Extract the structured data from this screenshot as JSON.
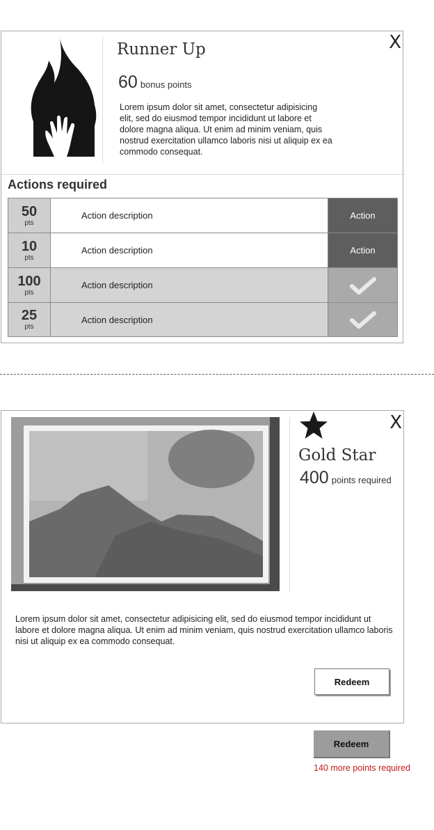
{
  "badge_card": {
    "icon": "flame-hand-icon",
    "title": "Runner Up",
    "points_value": "60",
    "points_label": "bonus points",
    "description": "Lorem ipsum dolor sit amet, consectetur adipisicing elit, sed do eiusmod tempor incididunt ut labore et dolore magna aliqua. Ut enim ad minim veniam, quis nostrud exercitation ullamco laboris nisi ut aliquip ex ea commodo consequat.",
    "close_label": "X",
    "actions_title": "Actions required",
    "actions": [
      {
        "points": "50",
        "unit": "pts",
        "description": "Action description",
        "state": "open",
        "button_label": "Action"
      },
      {
        "points": "10",
        "unit": "pts",
        "description": "Action description",
        "state": "open",
        "button_label": "Action"
      },
      {
        "points": "100",
        "unit": "pts",
        "description": "Action description",
        "state": "done",
        "icon": "checkmark-icon"
      },
      {
        "points": "25",
        "unit": "pts",
        "description": "Action description",
        "state": "done",
        "icon": "checkmark-icon"
      }
    ]
  },
  "reward_card": {
    "image": "image-placeholder",
    "icon": "star-icon",
    "title": "Gold Star",
    "points_value": "400",
    "points_label": "points required",
    "description": "Lorem ipsum dolor sit amet, consectetur adipisicing elit, sed do eiusmod tempor incididunt ut labore et dolore magna aliqua. Ut enim ad minim veniam, quis nostrud exercitation ullamco laboris nisi ut aliquip ex ea commodo consequat.",
    "close_label": "X",
    "redeem_label": "Redeem"
  },
  "disabled_redeem": {
    "label": "Redeem",
    "note": "140 more points required"
  },
  "colors": {
    "action_button": "#5e5e5e",
    "done_cell": "#aaaaaa",
    "points_cell": "#cfcfcf",
    "warning_text": "#c21a1a"
  }
}
